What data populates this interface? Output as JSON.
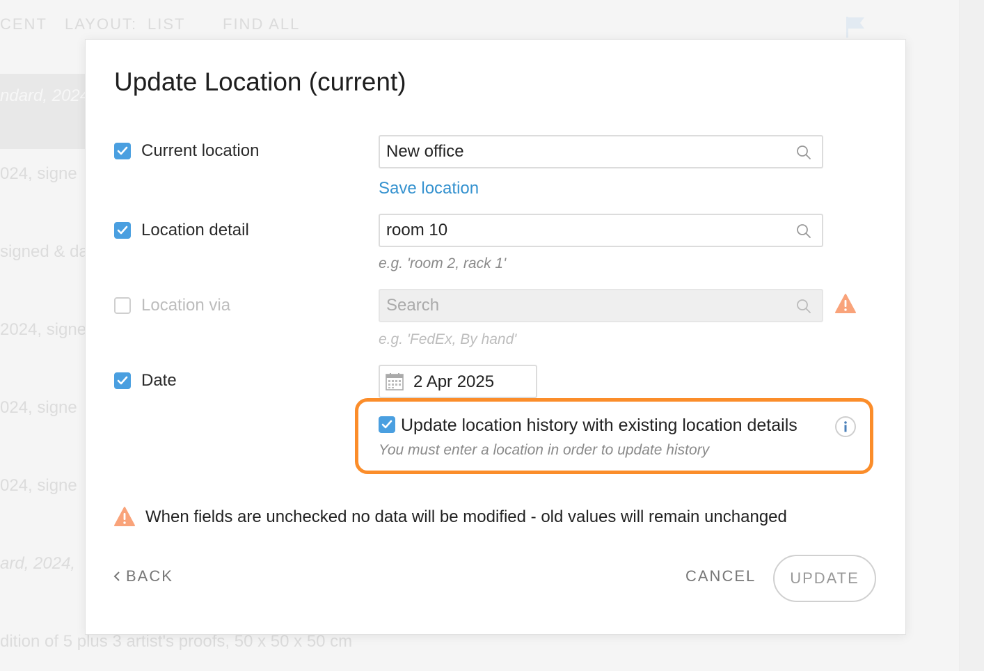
{
  "background": {
    "topbar": {
      "recent_label": "CENT",
      "layout_label": "LAYOUT:",
      "layout_value": "LIST",
      "find_all_label": "FIND ALL"
    },
    "rows": [
      "ndard, 2024",
      "024, signe",
      "signed & da",
      "2024, signe",
      "024, signe",
      "024, signe",
      "ard, 2024,",
      "dition of 5 plus 3 artist's proofs, 50 x 50 x 50 cm"
    ]
  },
  "modal": {
    "title": "Update Location (current)",
    "fields": {
      "current_location": {
        "label": "Current location",
        "checked": true,
        "value": "New office",
        "save_link": "Save location"
      },
      "location_detail": {
        "label": "Location detail",
        "checked": true,
        "value": "room 10",
        "hint": "e.g. 'room 2, rack 1'"
      },
      "location_via": {
        "label": "Location via",
        "checked": false,
        "placeholder": "Search",
        "hint": "e.g. 'FedEx, By hand'"
      },
      "date": {
        "label": "Date",
        "checked": true,
        "value": "2 Apr 2025"
      }
    },
    "history": {
      "checked": true,
      "label": "Update location history with existing location details",
      "note": "You must enter a location in order to update history"
    },
    "notice": "When fields are unchecked no data will be modified - old values will remain unchanged",
    "buttons": {
      "back": "BACK",
      "cancel": "CANCEL",
      "update": "UPDATE"
    }
  },
  "colors": {
    "accent": "#4a9fe0",
    "link": "#3592cf",
    "highlight": "#fb8d2a",
    "warning": "#f9a37a"
  }
}
